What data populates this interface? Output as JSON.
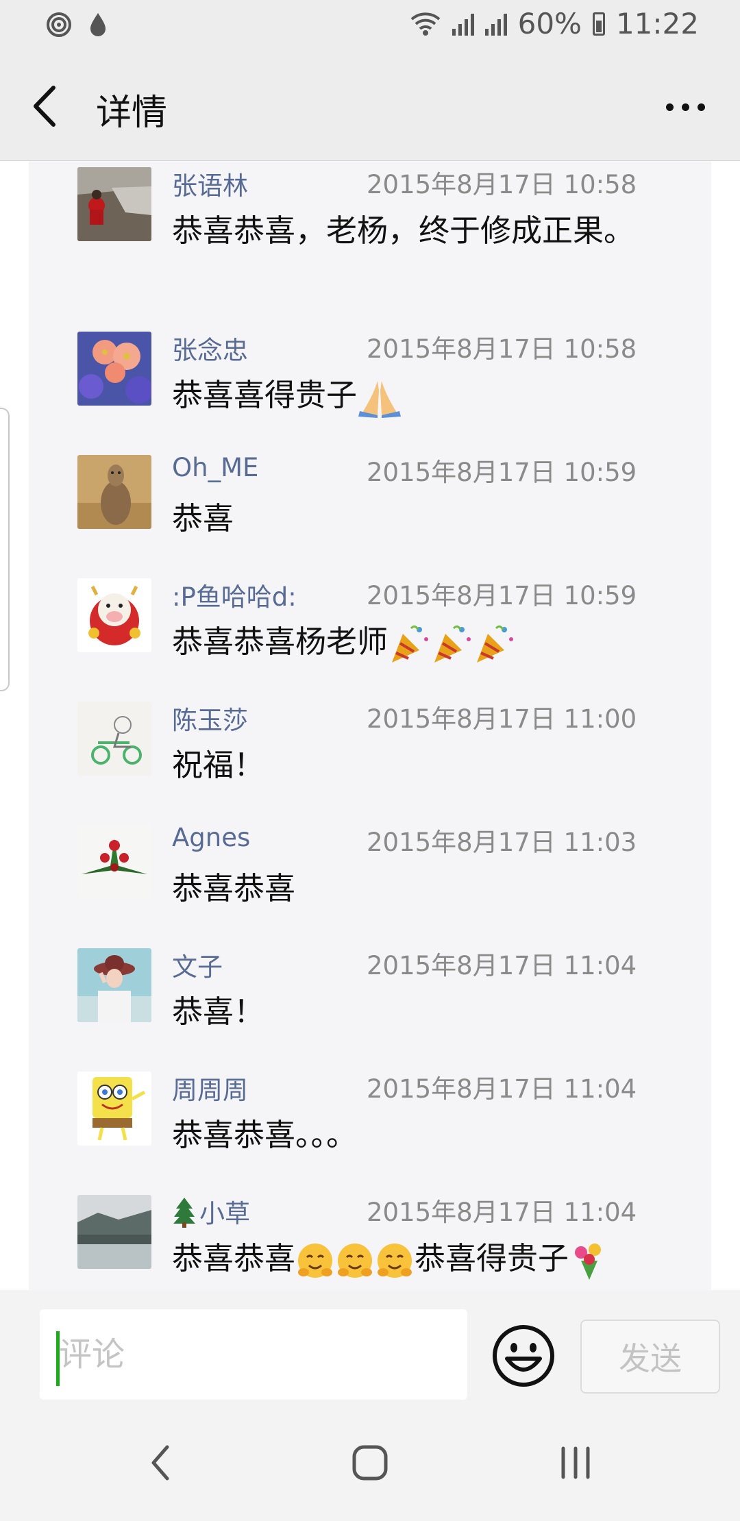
{
  "status_bar": {
    "battery_percent": "60%",
    "time": "11:22"
  },
  "header": {
    "title": "详情"
  },
  "comments": [
    {
      "name": "张语林",
      "time": "2015年8月17日 10:58",
      "text": "恭喜恭喜，老杨，终于修成正果。",
      "emojis": []
    },
    {
      "name": "张念忠",
      "time": "2015年8月17日 10:58",
      "text": "恭喜喜得贵子",
      "emojis": [
        "folded-hands-icon"
      ]
    },
    {
      "name": "Oh_ME",
      "time": "2015年8月17日 10:59",
      "text": "恭喜",
      "emojis": []
    },
    {
      "name": ":P鱼哈哈d:",
      "time": "2015年8月17日 10:59",
      "text": "恭喜恭喜杨老师",
      "emojis": [
        "party-popper-icon",
        "party-popper-icon",
        "party-popper-icon"
      ]
    },
    {
      "name": "陈玉莎",
      "time": "2015年8月17日 11:00",
      "text": "祝福！",
      "emojis": []
    },
    {
      "name": "Agnes",
      "time": "2015年8月17日 11:03",
      "text": "恭喜恭喜",
      "emojis": []
    },
    {
      "name": "文子",
      "time": "2015年8月17日 11:04",
      "text": "恭喜！",
      "emojis": []
    },
    {
      "name": "周周周",
      "time": "2015年8月17日 11:04",
      "text": "恭喜恭喜。。。",
      "emojis": []
    },
    {
      "name": "小草",
      "name_prefix_icon": "tree-icon",
      "time": "2015年8月17日 11:04",
      "text": "恭喜恭喜",
      "text_tail": "恭喜得贵子",
      "emojis": [
        "hugging-face-icon",
        "hugging-face-icon",
        "hugging-face-icon"
      ],
      "tail_emoji": "bouquet-icon"
    }
  ],
  "input_bar": {
    "placeholder": "评论",
    "send_label": "发送"
  },
  "colors": {
    "name_link": "#576b95",
    "timestamp": "#8a8a8a",
    "cursor": "#1aad19"
  }
}
